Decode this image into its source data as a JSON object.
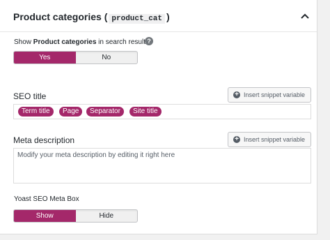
{
  "header": {
    "title": "Product categories",
    "open_paren": "(",
    "code": "product_cat",
    "close_paren": ")"
  },
  "search_question": {
    "prefix": "Show",
    "bold": "Product categories",
    "suffix": "in search results?",
    "help_icon": "?"
  },
  "search_toggle": {
    "options": [
      "Yes",
      "No"
    ],
    "selected": "Yes"
  },
  "seo_title": {
    "label": "SEO title",
    "button_icon": "+",
    "button_label": "Insert snippet variable",
    "pills": [
      "Term title",
      "Page",
      "Separator",
      "Site title"
    ]
  },
  "meta_description": {
    "label": "Meta description",
    "button_icon": "+",
    "button_label": "Insert snippet variable",
    "placeholder": "Modify your meta description by editing it right here"
  },
  "yoast_meta_box": {
    "label": "Yoast SEO Meta Box",
    "options": [
      "Show",
      "Hide"
    ],
    "selected": "Show"
  },
  "colors": {
    "accent": "#a4286a",
    "text": "#23282d",
    "border": "#dddddd"
  }
}
